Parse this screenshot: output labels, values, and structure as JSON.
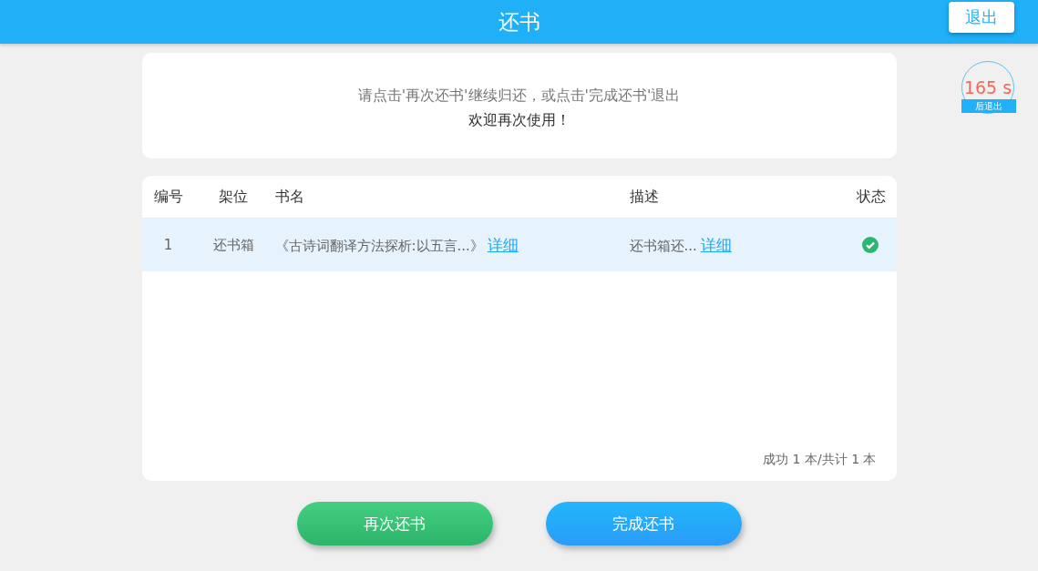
{
  "header": {
    "title": "还书",
    "exit_button": "退出"
  },
  "countdown": {
    "value": "165 s",
    "caption": "后退出"
  },
  "message": {
    "line_1": "请点击'再次还书'继续归还，或点击'完成还书'退出",
    "line_2": "欢迎再次使用！"
  },
  "table": {
    "columns": [
      "编号",
      "架位",
      "书名",
      "描述",
      "状态"
    ],
    "rows": [
      {
        "number": "1",
        "shelf": "还书箱",
        "title": "《古诗词翻译方法探析:以五言...》",
        "title_link": "详细",
        "description": "还书箱还...",
        "description_link": "详细",
        "returned": true,
        "selected": true
      }
    ],
    "summary": "成功 1 本/共计 1 本"
  },
  "buttons": [
    {
      "label": "再次还书",
      "kind": "continue"
    },
    {
      "label": "完成还书",
      "kind": "finish"
    }
  ]
}
